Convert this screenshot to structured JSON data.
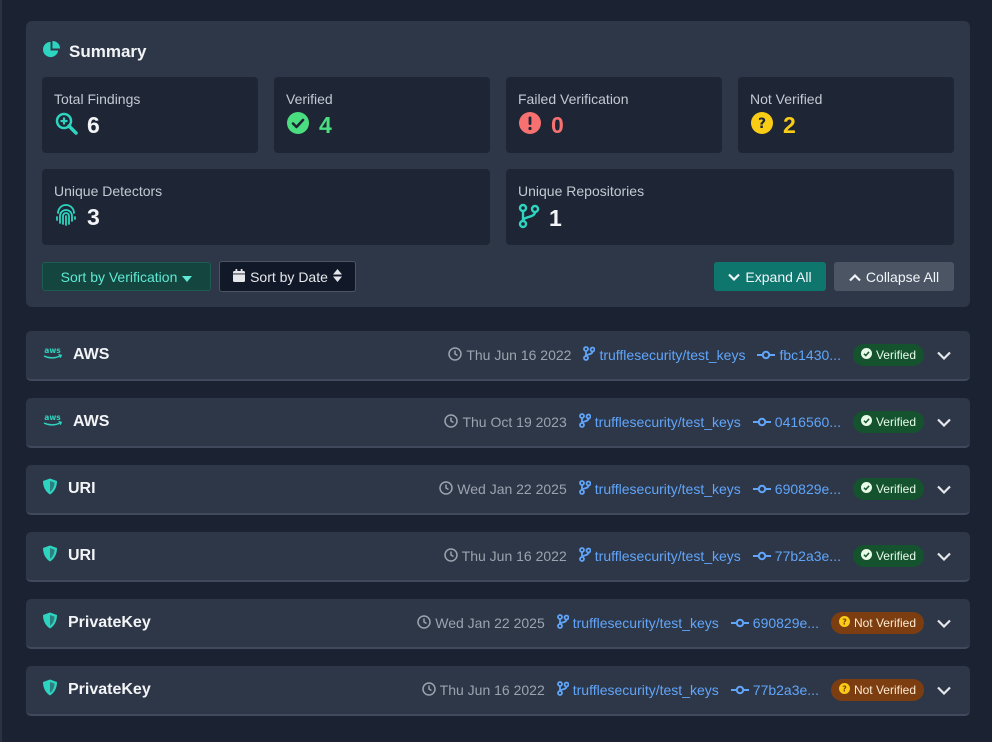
{
  "summary": {
    "title": "Summary",
    "cards": {
      "total": {
        "label": "Total Findings",
        "value": "6"
      },
      "verified": {
        "label": "Verified",
        "value": "4"
      },
      "failed": {
        "label": "Failed Verification",
        "value": "0"
      },
      "not_verified": {
        "label": "Not Verified",
        "value": "2"
      },
      "detectors": {
        "label": "Unique Detectors",
        "value": "3"
      },
      "repos": {
        "label": "Unique Repositories",
        "value": "1"
      }
    },
    "buttons": {
      "sort_verification": "Sort by Verification",
      "sort_date": "Sort by Date",
      "expand_all": "Expand All",
      "collapse_all": "Collapse All"
    }
  },
  "colors": {
    "verified": "#4ade80",
    "failed": "#f87171",
    "not_verified": "#facc15",
    "accent": "#2dd4bf",
    "link": "#60a5fa"
  },
  "findings": [
    {
      "icon": "aws-icon",
      "name": "AWS",
      "date": "Thu Jun 16 2022",
      "repo": "trufflesecurity/test_keys",
      "commit": "fbc1430...",
      "status": "Verified"
    },
    {
      "icon": "aws-icon",
      "name": "AWS",
      "date": "Thu Oct 19 2023",
      "repo": "trufflesecurity/test_keys",
      "commit": "0416560...",
      "status": "Verified"
    },
    {
      "icon": "shield-icon",
      "name": "URI",
      "date": "Wed Jan 22 2025",
      "repo": "trufflesecurity/test_keys",
      "commit": "690829e...",
      "status": "Verified"
    },
    {
      "icon": "shield-icon",
      "name": "URI",
      "date": "Thu Jun 16 2022",
      "repo": "trufflesecurity/test_keys",
      "commit": "77b2a3e...",
      "status": "Verified"
    },
    {
      "icon": "shield-icon",
      "name": "PrivateKey",
      "date": "Wed Jan 22 2025",
      "repo": "trufflesecurity/test_keys",
      "commit": "690829e...",
      "status": "Not Verified"
    },
    {
      "icon": "shield-icon",
      "name": "PrivateKey",
      "date": "Thu Jun 16 2022",
      "repo": "trufflesecurity/test_keys",
      "commit": "77b2a3e...",
      "status": "Not Verified"
    }
  ]
}
